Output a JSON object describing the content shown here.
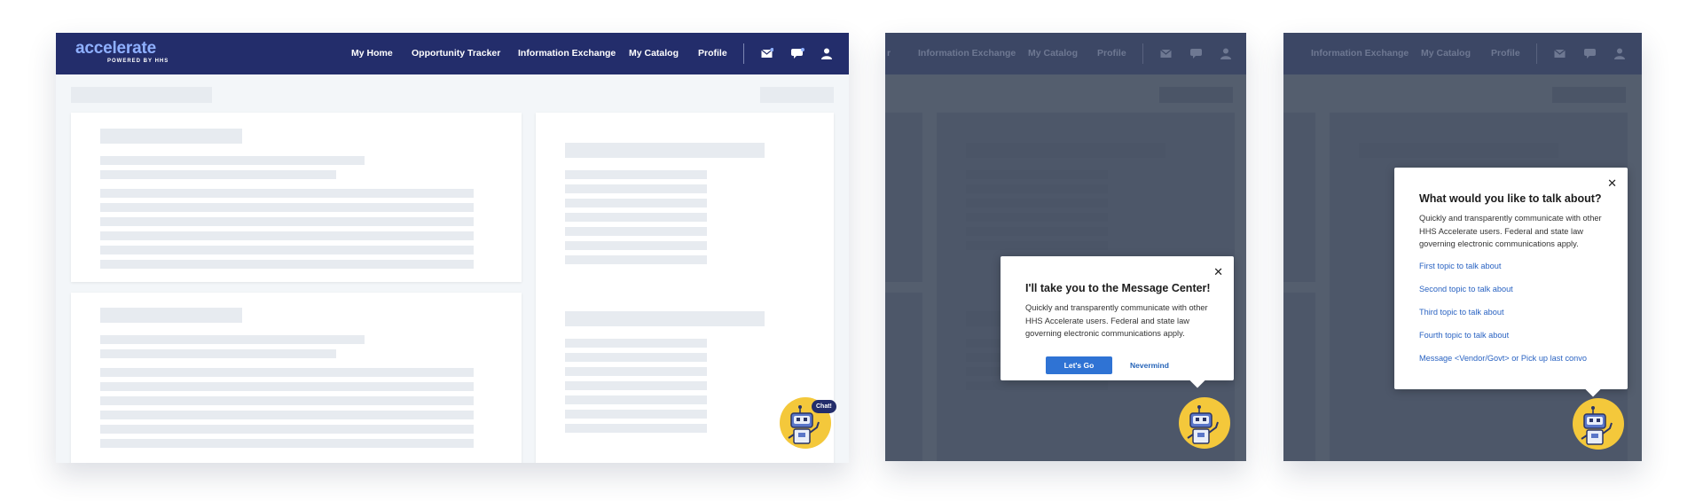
{
  "navbar": {
    "brand": "accelerate",
    "brand_sub": "POWERED BY HHS",
    "links": [
      "My Home",
      "Opportunity Tracker",
      "Information Exchange",
      "My Catalog",
      "Profile"
    ],
    "dim_links_panel2": [
      "r",
      "Information Exchange",
      "My Catalog",
      "Profile"
    ],
    "dim_links_panel3": [
      "Information Exchange",
      "My Catalog",
      "Profile"
    ],
    "icons": [
      "mail-icon",
      "chat-icon",
      "user-icon"
    ]
  },
  "chat_launcher": {
    "bubble_label": "Chat!",
    "icon": "robot-icon"
  },
  "message_center_popup": {
    "title": "I'll take you to the Message Center!",
    "body": "Quickly and transparently communicate with other HHS Accelerate users. Federal and state law governing electronic communications apply.",
    "primary_button": "Let's Go",
    "secondary_button": "Nevermind",
    "close_icon": "close-icon"
  },
  "topic_popup": {
    "title": "What would you like to talk about?",
    "body": "Quickly and transparently communicate with other HHS Accelerate users. Federal and state law governing electronic communications apply.",
    "topics": [
      "First topic to talk about",
      "Second topic to talk about",
      "Third topic to talk about",
      "Fourth topic to talk about",
      "Message <Vendor/Govt> or Pick up last convo"
    ],
    "close_icon": "close-icon"
  },
  "colors": {
    "navbar": "#232d6b",
    "brand": "#8fb0ff",
    "overlay": "#545e6e",
    "primary_button": "#2f73d4",
    "link": "#2a63c2",
    "bot_background": "#f4c83b"
  }
}
